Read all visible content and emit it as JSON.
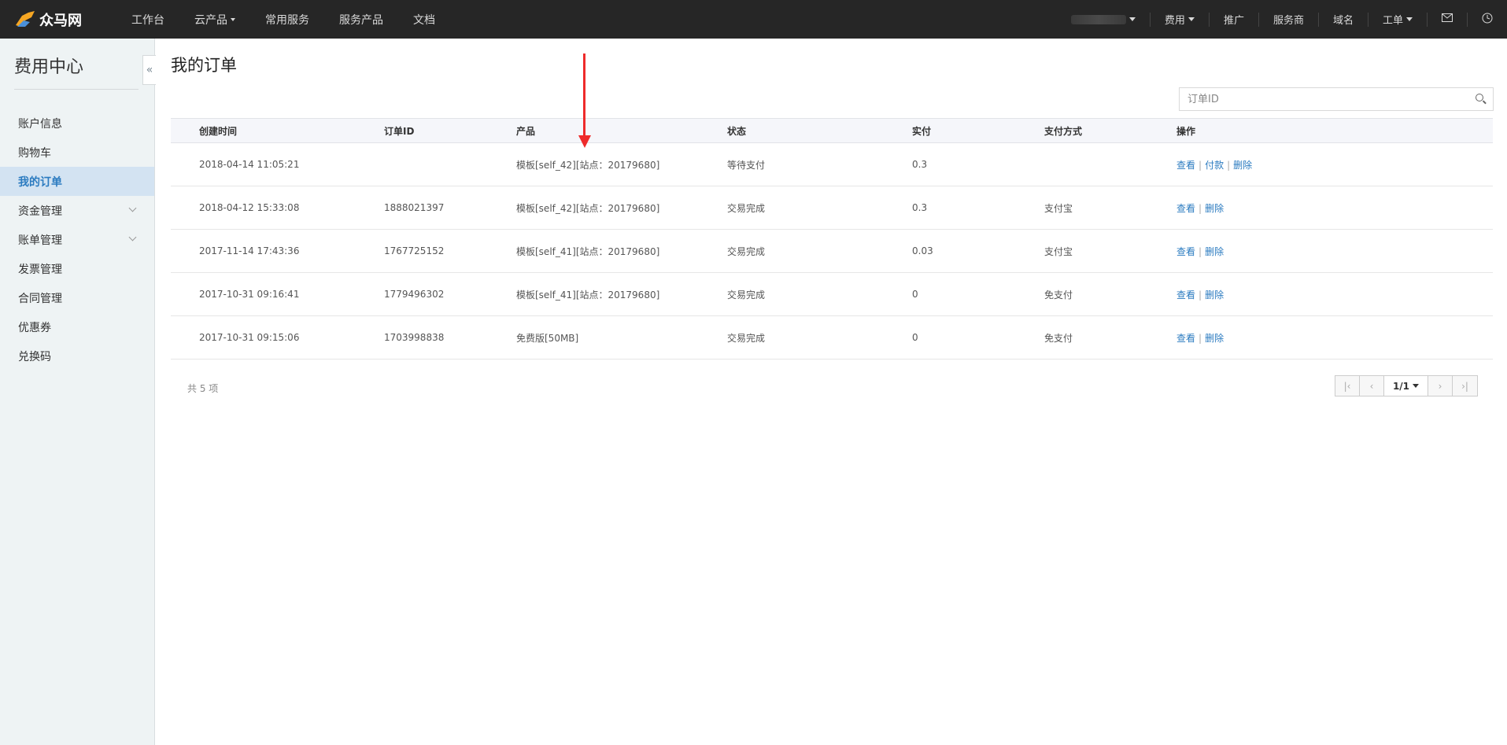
{
  "topbar": {
    "logo_text": "众马网",
    "nav": [
      {
        "label": "工作台",
        "has_caret": false
      },
      {
        "label": "云产品",
        "has_caret": true
      },
      {
        "label": "常用服务",
        "has_caret": false
      },
      {
        "label": "服务产品",
        "has_caret": false
      },
      {
        "label": "文档",
        "has_caret": false
      }
    ],
    "right": {
      "fee": "费用",
      "promote": "推广",
      "provider": "服务商",
      "domain": "域名",
      "ticket": "工单"
    }
  },
  "sidebar": {
    "title": "费用中心",
    "collapse_glyph": "«",
    "items": [
      {
        "label": "账户信息"
      },
      {
        "label": "购物车"
      },
      {
        "label": "我的订单"
      },
      {
        "label": "资金管理"
      },
      {
        "label": "账单管理"
      },
      {
        "label": "发票管理"
      },
      {
        "label": "合同管理"
      },
      {
        "label": "优惠券"
      },
      {
        "label": "兑换码"
      }
    ]
  },
  "main": {
    "title": "我的订单",
    "search_placeholder": "订单ID",
    "columns": [
      "创建时间",
      "订单ID",
      "产品",
      "状态",
      "实付",
      "支付方式",
      "操作"
    ],
    "rows": [
      {
        "time": "2018-04-14 11:05:21",
        "id": "",
        "product": "模板[self_42][站点：20179680]",
        "status": "等待支付",
        "paid": "0.3",
        "method": "",
        "actions": [
          "查看",
          "付款",
          "删除"
        ]
      },
      {
        "time": "2018-04-12 15:33:08",
        "id": "1888021397",
        "product": "模板[self_42][站点：20179680]",
        "status": "交易完成",
        "paid": "0.3",
        "method": "支付宝",
        "actions": [
          "查看",
          "删除"
        ]
      },
      {
        "time": "2017-11-14 17:43:36",
        "id": "1767725152",
        "product": "模板[self_41][站点：20179680]",
        "status": "交易完成",
        "paid": "0.03",
        "method": "支付宝",
        "actions": [
          "查看",
          "删除"
        ]
      },
      {
        "time": "2017-10-31 09:16:41",
        "id": "1779496302",
        "product": "模板[self_41][站点：20179680]",
        "status": "交易完成",
        "paid": "0",
        "method": "免支付",
        "actions": [
          "查看",
          "删除"
        ]
      },
      {
        "time": "2017-10-31 09:15:06",
        "id": "1703998838",
        "product": "免费版[50MB]",
        "status": "交易完成",
        "paid": "0",
        "method": "免支付",
        "actions": [
          "查看",
          "删除"
        ]
      }
    ],
    "total": "共 5 项",
    "pager": {
      "current": "1/1",
      "first_glyph": "|‹",
      "prev_glyph": "‹",
      "next_glyph": "›",
      "last_glyph": "›|"
    }
  },
  "colors": {
    "topbar_bg": "#262626",
    "sidebar_bg": "#eef3f4",
    "active_bg": "#d3e3f2",
    "link": "#2b7bc0",
    "annotation": "#ee2b2b"
  }
}
